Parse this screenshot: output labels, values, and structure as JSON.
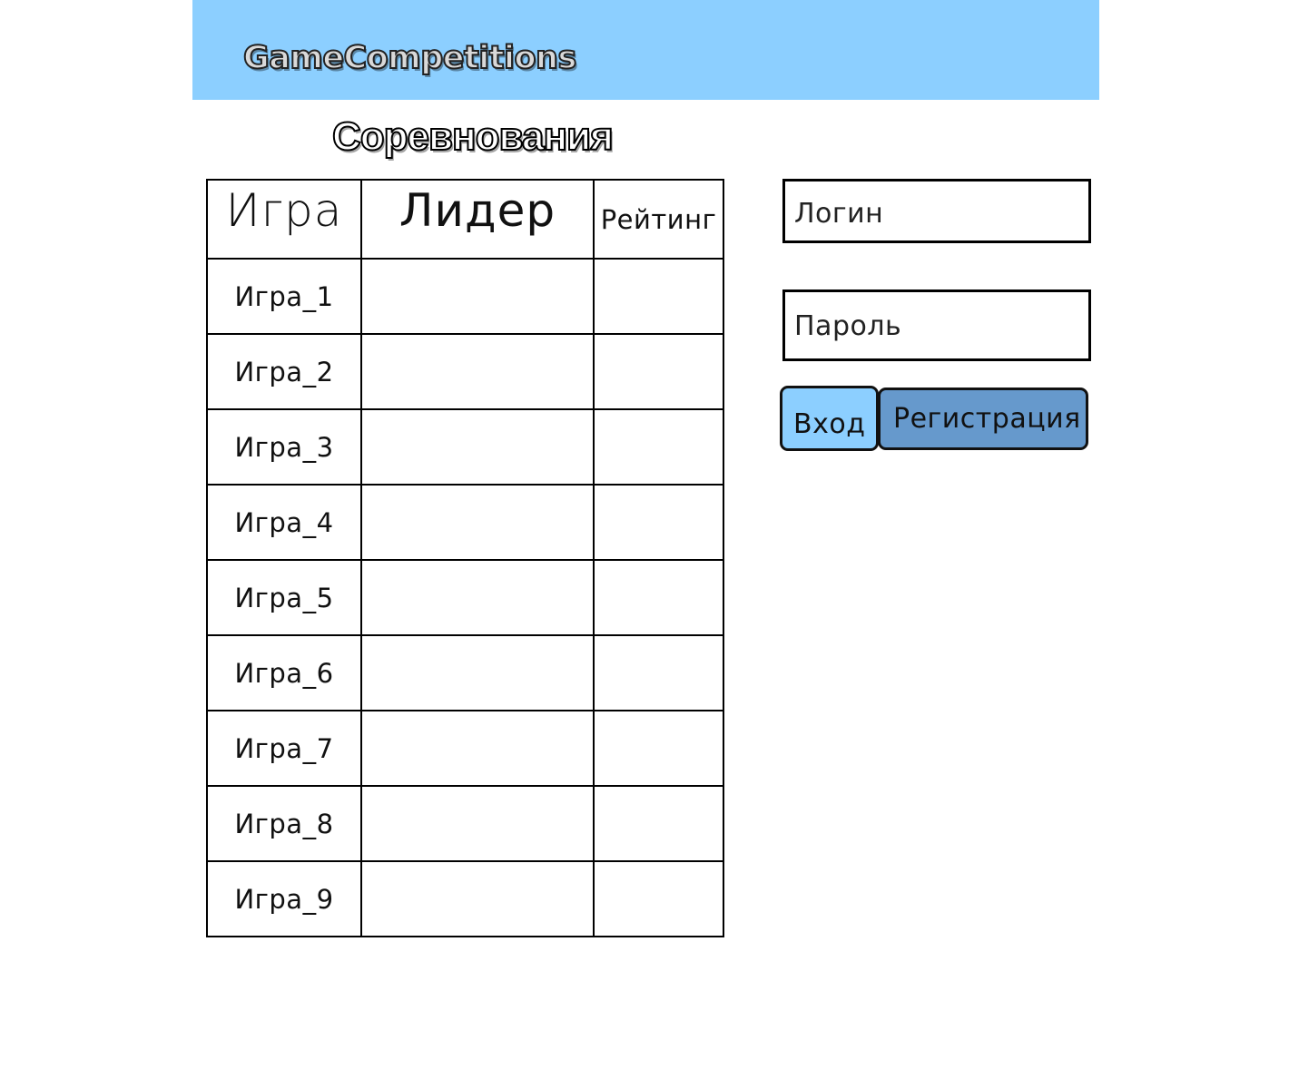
{
  "app": {
    "logo": "GameCompetitions",
    "header_color": "#8ccfff"
  },
  "page": {
    "title": "Соревнования"
  },
  "table": {
    "columns": [
      "Игра",
      "Лидер",
      "Рейтинг"
    ],
    "rows": [
      {
        "game": "Игра_1",
        "leader": "",
        "rating": ""
      },
      {
        "game": "Игра_2",
        "leader": "",
        "rating": ""
      },
      {
        "game": "Игра_3",
        "leader": "",
        "rating": ""
      },
      {
        "game": "Игра_4",
        "leader": "",
        "rating": ""
      },
      {
        "game": "Игра_5",
        "leader": "",
        "rating": ""
      },
      {
        "game": "Игра_6",
        "leader": "",
        "rating": ""
      },
      {
        "game": "Игра_7",
        "leader": "",
        "rating": ""
      },
      {
        "game": "Игра_8",
        "leader": "",
        "rating": ""
      },
      {
        "game": "Игра_9",
        "leader": "",
        "rating": ""
      }
    ]
  },
  "auth": {
    "login_placeholder": "Логин",
    "password_placeholder": "Пароль",
    "login_button": "Вход",
    "register_button": "Регистрация",
    "login_button_color": "#8ccfff",
    "register_button_color": "#6699cc"
  }
}
